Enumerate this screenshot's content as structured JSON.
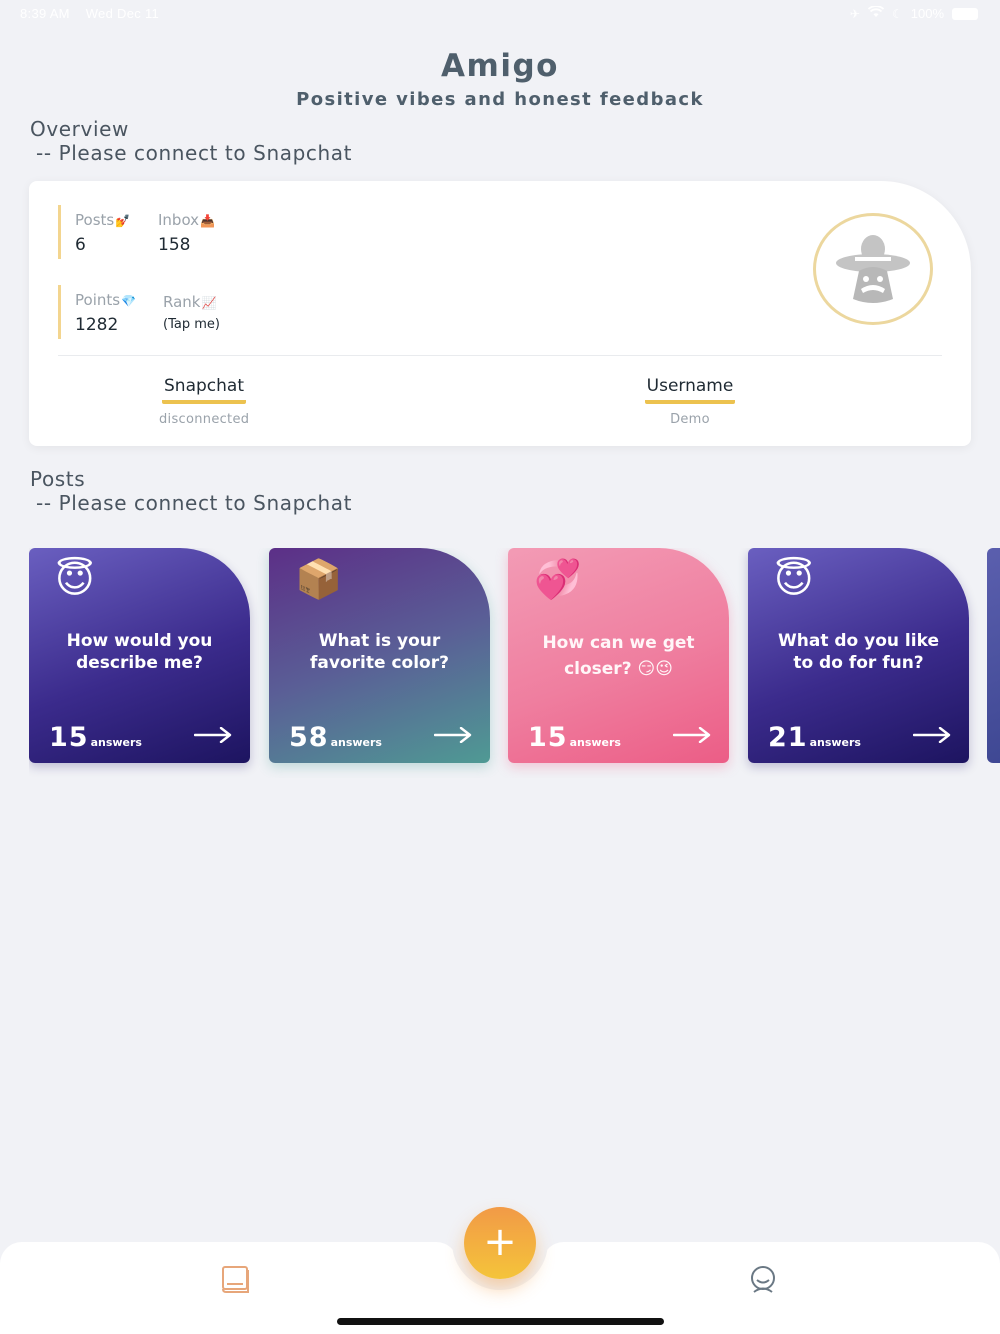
{
  "status_bar": {
    "time": "8:39 AM",
    "date": "Wed Dec 11",
    "battery": "100%"
  },
  "header": {
    "title": "Amigo",
    "subtitle": "Positive vibes and honest feedback"
  },
  "overview": {
    "heading": "Overview",
    "sub": "-- Please connect to Snapchat",
    "stats": {
      "posts_label": "Posts",
      "posts_emoji": "💅",
      "posts_value": "6",
      "inbox_label": "Inbox",
      "inbox_emoji": "📥",
      "inbox_value": "158",
      "points_label": "Points",
      "points_emoji": "💎",
      "points_value": "1282",
      "rank_label": "Rank",
      "rank_emoji": "📈",
      "rank_value": "(Tap me)"
    },
    "snapchat_label": "Snapchat",
    "snapchat_status": "disconnected",
    "username_label": "Username",
    "username_value": "Demo"
  },
  "posts_section": {
    "heading": "Posts",
    "sub": "-- Please connect to Snapchat"
  },
  "posts": [
    {
      "emoji": "😇",
      "question": "How would you describe me?",
      "count": "15",
      "unit": "answers"
    },
    {
      "emoji": "📦",
      "question": "What is your favorite color?",
      "count": "58",
      "unit": "answers"
    },
    {
      "emoji": "💞",
      "question": "How can we get closer? 😏😉",
      "count": "15",
      "unit": "answers"
    },
    {
      "emoji": "😇",
      "question": "What do you like to do for fun?",
      "count": "21",
      "unit": "answers"
    }
  ],
  "fab": {
    "label": "+"
  },
  "colors": {
    "accent_gold": "#ecc24f",
    "fab_orange": "#f29a47",
    "tab_icon_orange": "#e7a67a",
    "tab_icon_gray": "#6a7884"
  },
  "icons": {
    "posts_tab": "book-icon",
    "profile_tab": "user-icon",
    "arrow": "arrow-right-icon"
  }
}
